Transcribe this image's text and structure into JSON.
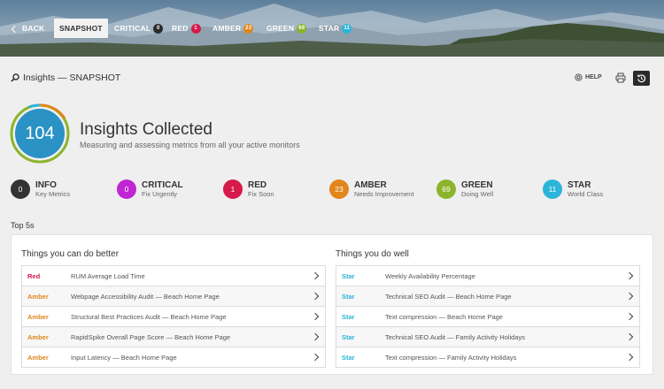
{
  "nav": {
    "back_label": "BACK",
    "snapshot_label": "SNAPSHOT",
    "critical": {
      "label": "CRITICAL",
      "count": "0"
    },
    "red": {
      "label": "RED",
      "count": "1"
    },
    "amber": {
      "label": "AMBER",
      "count": "23"
    },
    "green": {
      "label": "GREEN",
      "count": "69"
    },
    "star": {
      "label": "STAR",
      "count": "11"
    }
  },
  "toolbar": {
    "title": "Insights — SNAPSHOT",
    "help_label": "HELP"
  },
  "summary": {
    "total": "104",
    "title": "Insights Collected",
    "subtitle": "Measuring and assessing metrics from all your active monitors"
  },
  "categories": [
    {
      "count": "0",
      "name": "INFO",
      "desc": "Key Metrics"
    },
    {
      "count": "0",
      "name": "CRITICAL",
      "desc": "Fix Urgently"
    },
    {
      "count": "1",
      "name": "RED",
      "desc": "Fix Soon"
    },
    {
      "count": "23",
      "name": "AMBER",
      "desc": "Needs Improvement"
    },
    {
      "count": "69",
      "name": "GREEN",
      "desc": "Doing Well"
    },
    {
      "count": "11",
      "name": "STAR",
      "desc": "World Class"
    }
  ],
  "top5": {
    "section_label": "Top 5s",
    "better": {
      "title": "Things you can do better",
      "rows": [
        {
          "status": "Red",
          "label": "RUM Average Load Time"
        },
        {
          "status": "Amber",
          "label": "Webpage Accessibility Audit — Beach Home Page"
        },
        {
          "status": "Amber",
          "label": "Structural Best Practices Audit — Beach Home Page"
        },
        {
          "status": "Amber",
          "label": "RapidSpike Overall Page Score — Beach Home Page"
        },
        {
          "status": "Amber",
          "label": "Input Latency — Beach Home Page"
        }
      ]
    },
    "well": {
      "title": "Things you do well",
      "rows": [
        {
          "status": "Star",
          "label": "Weekly Availability Percentage"
        },
        {
          "status": "Star",
          "label": "Technical SEO Audit — Beach Home Page"
        },
        {
          "status": "Star",
          "label": "Text compression — Beach Home Page"
        },
        {
          "status": "Star",
          "label": "Technical SEO Audit — Family Activity Holidays"
        },
        {
          "status": "Star",
          "label": "Text compression — Family Activity Holidays"
        }
      ]
    }
  },
  "colors": {
    "info": "#333333",
    "critical": "#c026d3",
    "red": "#d61a4a",
    "amber": "#e0861b",
    "green": "#8bb42a",
    "star": "#2bb5d9",
    "total": "#2a92c4"
  }
}
